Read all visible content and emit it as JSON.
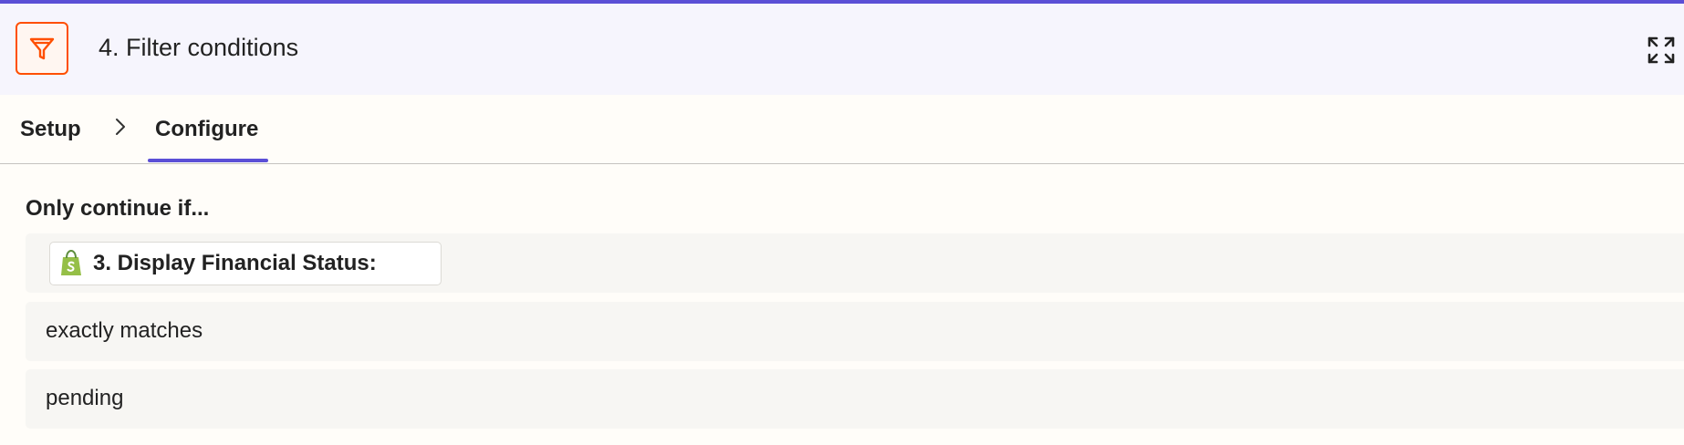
{
  "colors": {
    "accent": "#5b4fd6",
    "filter_orange": "#ff4f00",
    "shopify_green": "#95bf47",
    "header_bg": "#f6f5fd",
    "row_bg": "#f7f6f3"
  },
  "header": {
    "icon": "filter-icon",
    "title": "4. Filter conditions",
    "expand_icon": "expand-icon"
  },
  "tabs": {
    "items": [
      {
        "label": "Setup",
        "active": false
      },
      {
        "label": "Configure",
        "active": true
      }
    ],
    "separator_icon": "chevron-right-icon"
  },
  "filter": {
    "heading": "Only continue if...",
    "field": {
      "app_icon": "shopify-icon",
      "label": "3. Display Financial Status:"
    },
    "operator": "exactly matches",
    "value": "pending"
  }
}
